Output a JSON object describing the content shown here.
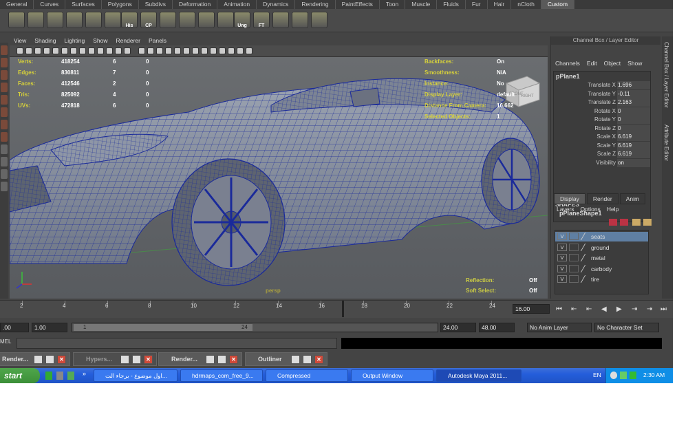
{
  "shelf_tabs": [
    "General",
    "Curves",
    "Surfaces",
    "Polygons",
    "Subdivs",
    "Deformation",
    "Animation",
    "Dynamics",
    "Rendering",
    "PaintEffects",
    "Toon",
    "Muscle",
    "Fluids",
    "Fur",
    "Hair",
    "nCloth",
    "Custom"
  ],
  "shelf_active": "Custom",
  "shelf_icon_labels": [
    "His",
    "CP",
    "Ung",
    "FT"
  ],
  "viewport_menu": [
    "View",
    "Shading",
    "Lighting",
    "Show",
    "Renderer",
    "Panels"
  ],
  "hud_left": {
    "rows": [
      {
        "label": "Verts:",
        "a": "418254",
        "b": "6",
        "c": "0"
      },
      {
        "label": "Edges:",
        "a": "830811",
        "b": "7",
        "c": "0"
      },
      {
        "label": "Faces:",
        "a": "412546",
        "b": "2",
        "c": "0"
      },
      {
        "label": "Tris:",
        "a": "825092",
        "b": "4",
        "c": "0"
      },
      {
        "label": "UVs:",
        "a": "472818",
        "b": "6",
        "c": "0"
      }
    ]
  },
  "hud_right": {
    "rows": [
      {
        "label": "Backfaces:",
        "value": "On"
      },
      {
        "label": "Smoothness:",
        "value": "N/A"
      },
      {
        "label": "Instance:",
        "value": "No"
      },
      {
        "label": "Display Layer:",
        "value": "default"
      },
      {
        "label": "Distance From Camera:",
        "value": "16.662"
      },
      {
        "label": "Selected Objects:",
        "value": "1"
      }
    ]
  },
  "hud_bottom": {
    "reflection_label": "Reflection:",
    "reflection_value": "Off",
    "softselect_label": "Soft Select:",
    "softselect_value": "Off",
    "camera": "persp"
  },
  "viewcube": {
    "front": "FRONT",
    "right": "RIGHT"
  },
  "channel_box": {
    "title": "Channel Box / Layer Editor",
    "menu": [
      "Channels",
      "Edit",
      "Object",
      "Show"
    ],
    "object": "pPlane1",
    "attrs": [
      {
        "label": "Translate X",
        "value": "1.696"
      },
      {
        "label": "Translate Y",
        "value": "-0.11"
      },
      {
        "label": "Translate Z",
        "value": "2.163"
      },
      {
        "label": "Rotate X",
        "value": "0"
      },
      {
        "label": "Rotate Y",
        "value": "0"
      },
      {
        "label": "Rotate Z",
        "value": "0"
      },
      {
        "label": "Scale X",
        "value": "6.619"
      },
      {
        "label": "Scale Y",
        "value": "6.619"
      },
      {
        "label": "Scale Z",
        "value": "6.619"
      },
      {
        "label": "Visibility",
        "value": "on"
      }
    ],
    "shapes_label": "SHAPES",
    "shape": "pPlaneShape1"
  },
  "side_tabs": [
    "Channel Box / Layer Editor",
    "Attribute Editor"
  ],
  "layer_editor": {
    "tabs": [
      "Display",
      "Render",
      "Anim"
    ],
    "active_tab": "Display",
    "menu": [
      "Layers",
      "Options",
      "Help"
    ],
    "layers": [
      {
        "v": "V",
        "name": "seats",
        "selected": true
      },
      {
        "v": "V",
        "name": "ground",
        "selected": false
      },
      {
        "v": "V",
        "name": "metal",
        "selected": false
      },
      {
        "v": "V",
        "name": "carbody",
        "selected": false
      },
      {
        "v": "V",
        "name": "tire",
        "selected": false
      }
    ]
  },
  "time_slider": {
    "ticks": [
      "2",
      "4",
      "6",
      "8",
      "10",
      "12",
      "14",
      "16",
      "18",
      "20",
      "22",
      "24"
    ],
    "current_frame": "16.00"
  },
  "range_slider": {
    "start": ".00",
    "range_start": "1.00",
    "handle_start": "1",
    "handle_end": "24",
    "range_end": "24.00",
    "end": "48.00",
    "anim_layer": "No Anim Layer",
    "character_set": "No Character Set"
  },
  "command_line": {
    "label": "MEL"
  },
  "minimized_windows": [
    {
      "title": "Render..."
    },
    {
      "title": "Hypers..."
    },
    {
      "title": "Render..."
    },
    {
      "title": "Outliner"
    }
  ],
  "taskbar": {
    "start": "start",
    "items": [
      "اول موضوع - برجاء الت...",
      "hdrmaps_com_free_9...",
      "Compressed",
      "Output Window",
      "Autodesk Maya 2011..."
    ],
    "active_item": "Autodesk Maya 2011...",
    "lang": "EN",
    "clock": "2:30 AM"
  },
  "colors": {
    "hud_label": "#d8d23a",
    "wire": "#1a2a9a",
    "selection": "#5f7fa3"
  }
}
